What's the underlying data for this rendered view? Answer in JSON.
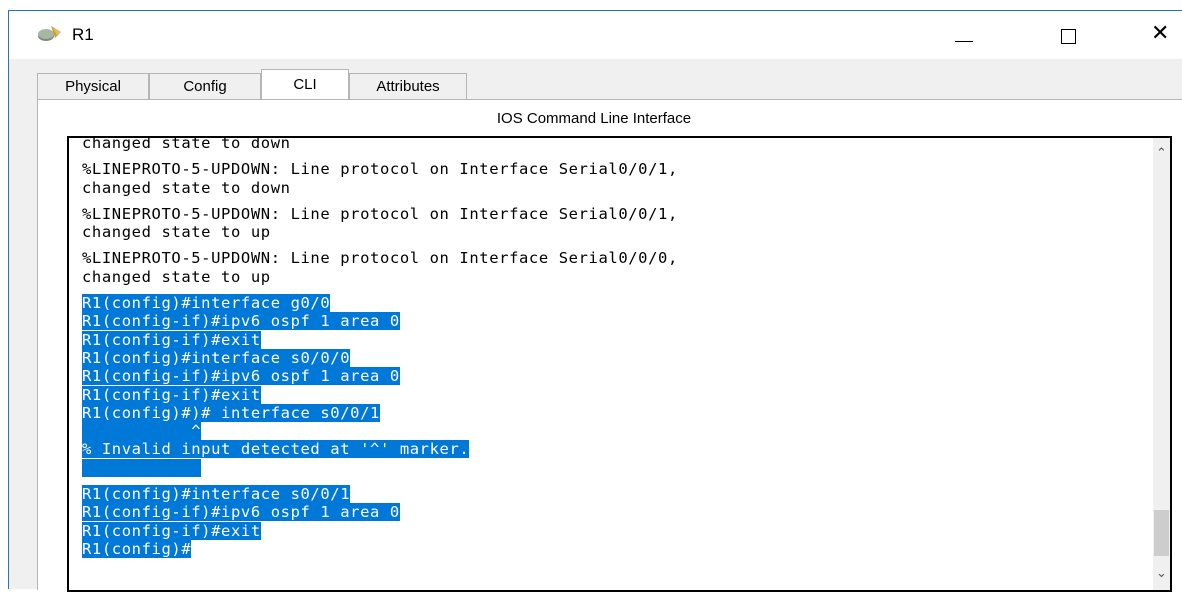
{
  "window": {
    "title": "R1",
    "icon": "router-icon",
    "controls": {
      "minimize": "—",
      "maximize": "☐",
      "close": "✕"
    }
  },
  "tabs": [
    {
      "label": "Physical",
      "active": false
    },
    {
      "label": "Config",
      "active": false
    },
    {
      "label": "CLI",
      "active": true
    },
    {
      "label": "Attributes",
      "active": false
    }
  ],
  "panel": {
    "heading": "IOS Command Line Interface"
  },
  "console": {
    "lines": [
      {
        "text": "changed state to down",
        "selected": false,
        "gap_after": true
      },
      {
        "text": "%LINEPROTO-5-UPDOWN: Line protocol on Interface Serial0/0/1,",
        "selected": false
      },
      {
        "text": "changed state to down",
        "selected": false,
        "gap_after": true
      },
      {
        "text": "%LINEPROTO-5-UPDOWN: Line protocol on Interface Serial0/0/1,",
        "selected": false
      },
      {
        "text": "changed state to up",
        "selected": false,
        "gap_after": true
      },
      {
        "text": "%LINEPROTO-5-UPDOWN: Line protocol on Interface Serial0/0/0,",
        "selected": false
      },
      {
        "text": "changed state to up",
        "selected": false,
        "gap_after": true
      },
      {
        "text": "R1(config)#interface g0/0",
        "selected": true
      },
      {
        "text": "R1(config-if)#ipv6 ospf 1 area 0",
        "selected": true
      },
      {
        "text": "R1(config-if)#exit",
        "selected": true
      },
      {
        "text": "R1(config)#interface s0/0/0",
        "selected": true
      },
      {
        "text": "R1(config-if)#ipv6 ospf 1 area 0",
        "selected": true
      },
      {
        "text": "R1(config-if)#exit",
        "selected": true
      },
      {
        "text": "R1(config)#)# interface s0/0/1",
        "selected": true
      },
      {
        "text": "           ^",
        "selected": true
      },
      {
        "text": "% Invalid input detected at '^' marker.",
        "selected": true
      },
      {
        "text": "            ",
        "selected": true,
        "gap_after": true
      },
      {
        "text": "R1(config)#interface s0/0/1",
        "selected": true
      },
      {
        "text": "R1(config-if)#ipv6 ospf 1 area 0",
        "selected": true
      },
      {
        "text": "R1(config-if)#exit",
        "selected": true
      },
      {
        "text": "R1(config)#",
        "selected": true
      }
    ]
  },
  "scrollbar": {
    "up": "^",
    "down": "v"
  }
}
